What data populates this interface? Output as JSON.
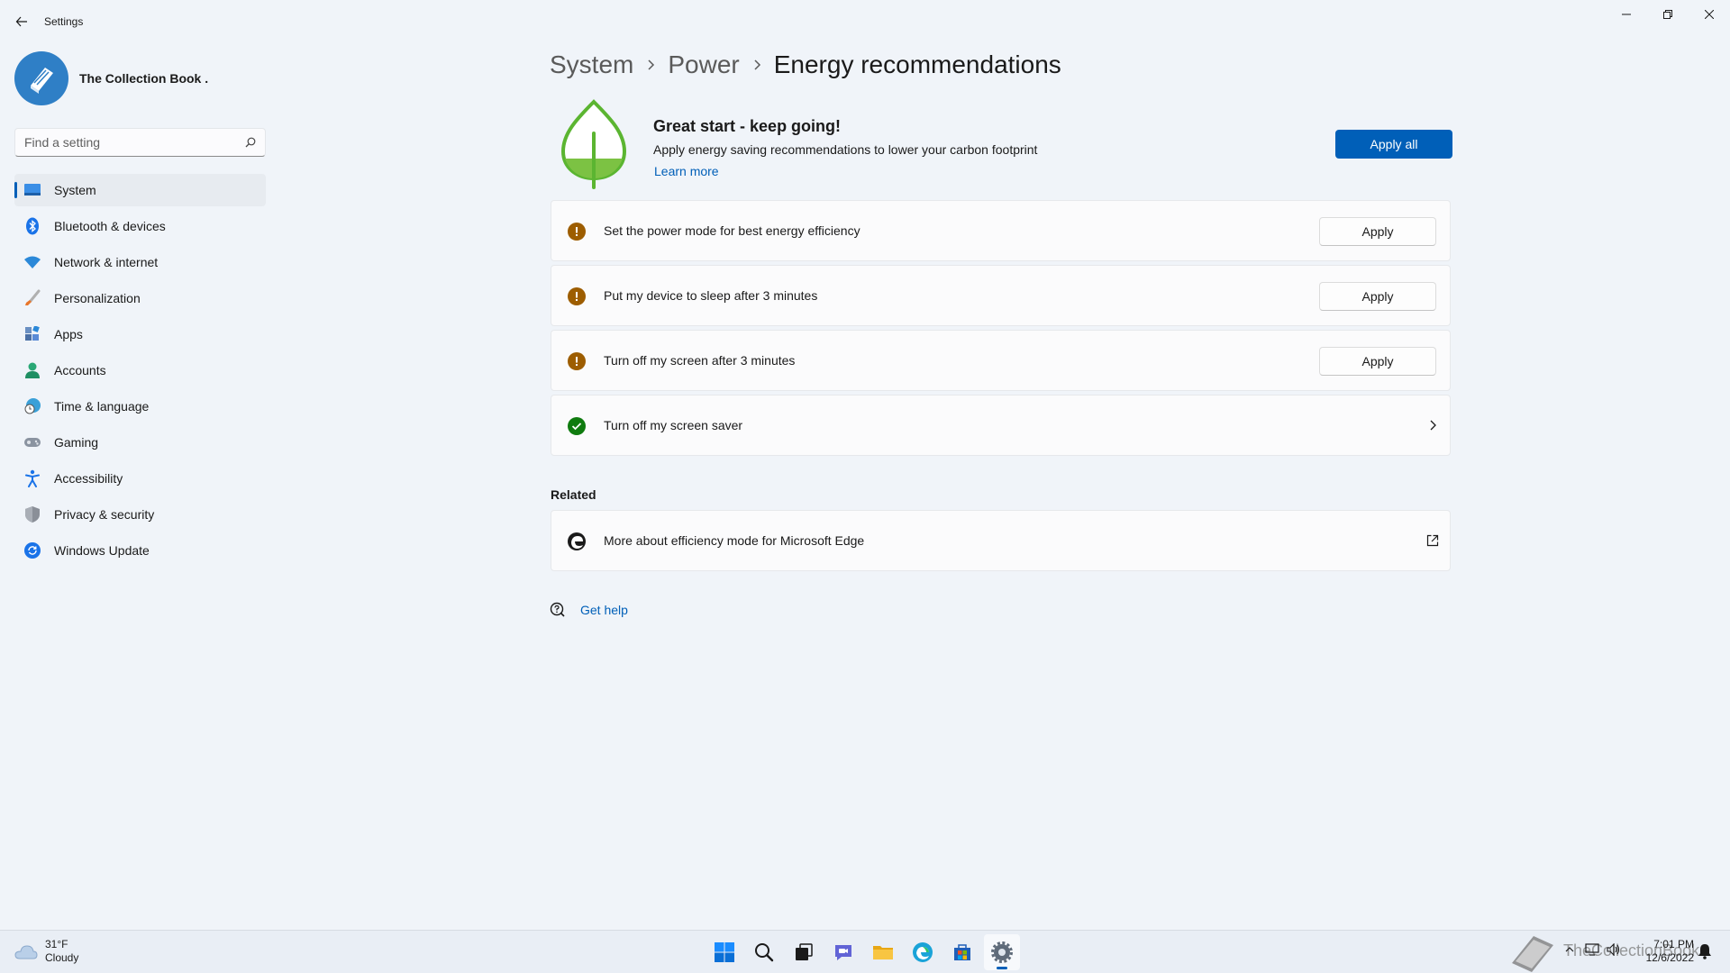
{
  "window": {
    "title": "Settings"
  },
  "profile": {
    "name": "The Collection Book ."
  },
  "search": {
    "placeholder": "Find a setting"
  },
  "sidebar": {
    "items": [
      {
        "label": "System",
        "icon": "system-icon",
        "active": true
      },
      {
        "label": "Bluetooth & devices",
        "icon": "bluetooth-icon"
      },
      {
        "label": "Network & internet",
        "icon": "wifi-icon"
      },
      {
        "label": "Personalization",
        "icon": "brush-icon"
      },
      {
        "label": "Apps",
        "icon": "apps-icon"
      },
      {
        "label": "Accounts",
        "icon": "person-icon"
      },
      {
        "label": "Time & language",
        "icon": "globe-clock-icon"
      },
      {
        "label": "Gaming",
        "icon": "gamepad-icon"
      },
      {
        "label": "Accessibility",
        "icon": "accessibility-icon"
      },
      {
        "label": "Privacy & security",
        "icon": "shield-icon"
      },
      {
        "label": "Windows Update",
        "icon": "update-icon"
      }
    ]
  },
  "breadcrumb": {
    "items": [
      "System",
      "Power"
    ],
    "current": "Energy recommendations"
  },
  "hero": {
    "title": "Great start - keep going!",
    "description": "Apply energy saving recommendations to lower your carbon footprint",
    "link": "Learn more",
    "apply_all": "Apply all"
  },
  "recommendations": [
    {
      "text": "Set the power mode for best energy efficiency",
      "status": "warning",
      "action": "Apply"
    },
    {
      "text": "Put my device to sleep after 3 minutes",
      "status": "warning",
      "action": "Apply"
    },
    {
      "text": "Turn off my screen after 3 minutes",
      "status": "warning",
      "action": "Apply"
    },
    {
      "text": "Turn off my screen saver",
      "status": "done"
    }
  ],
  "related": {
    "title": "Related",
    "items": [
      {
        "text": "More about efficiency mode for Microsoft Edge",
        "icon": "edge-icon"
      }
    ]
  },
  "help": {
    "label": "Get help"
  },
  "taskbar": {
    "weather_temp": "31°F",
    "weather_desc": "Cloudy",
    "time": "7:01 PM",
    "date": "12/6/2022",
    "watermark": "TheCollectionBook"
  },
  "colors": {
    "accent": "#005fb8",
    "warning": "#9d5d00",
    "success": "#0f7b0f",
    "leaf": "#5bb531"
  }
}
